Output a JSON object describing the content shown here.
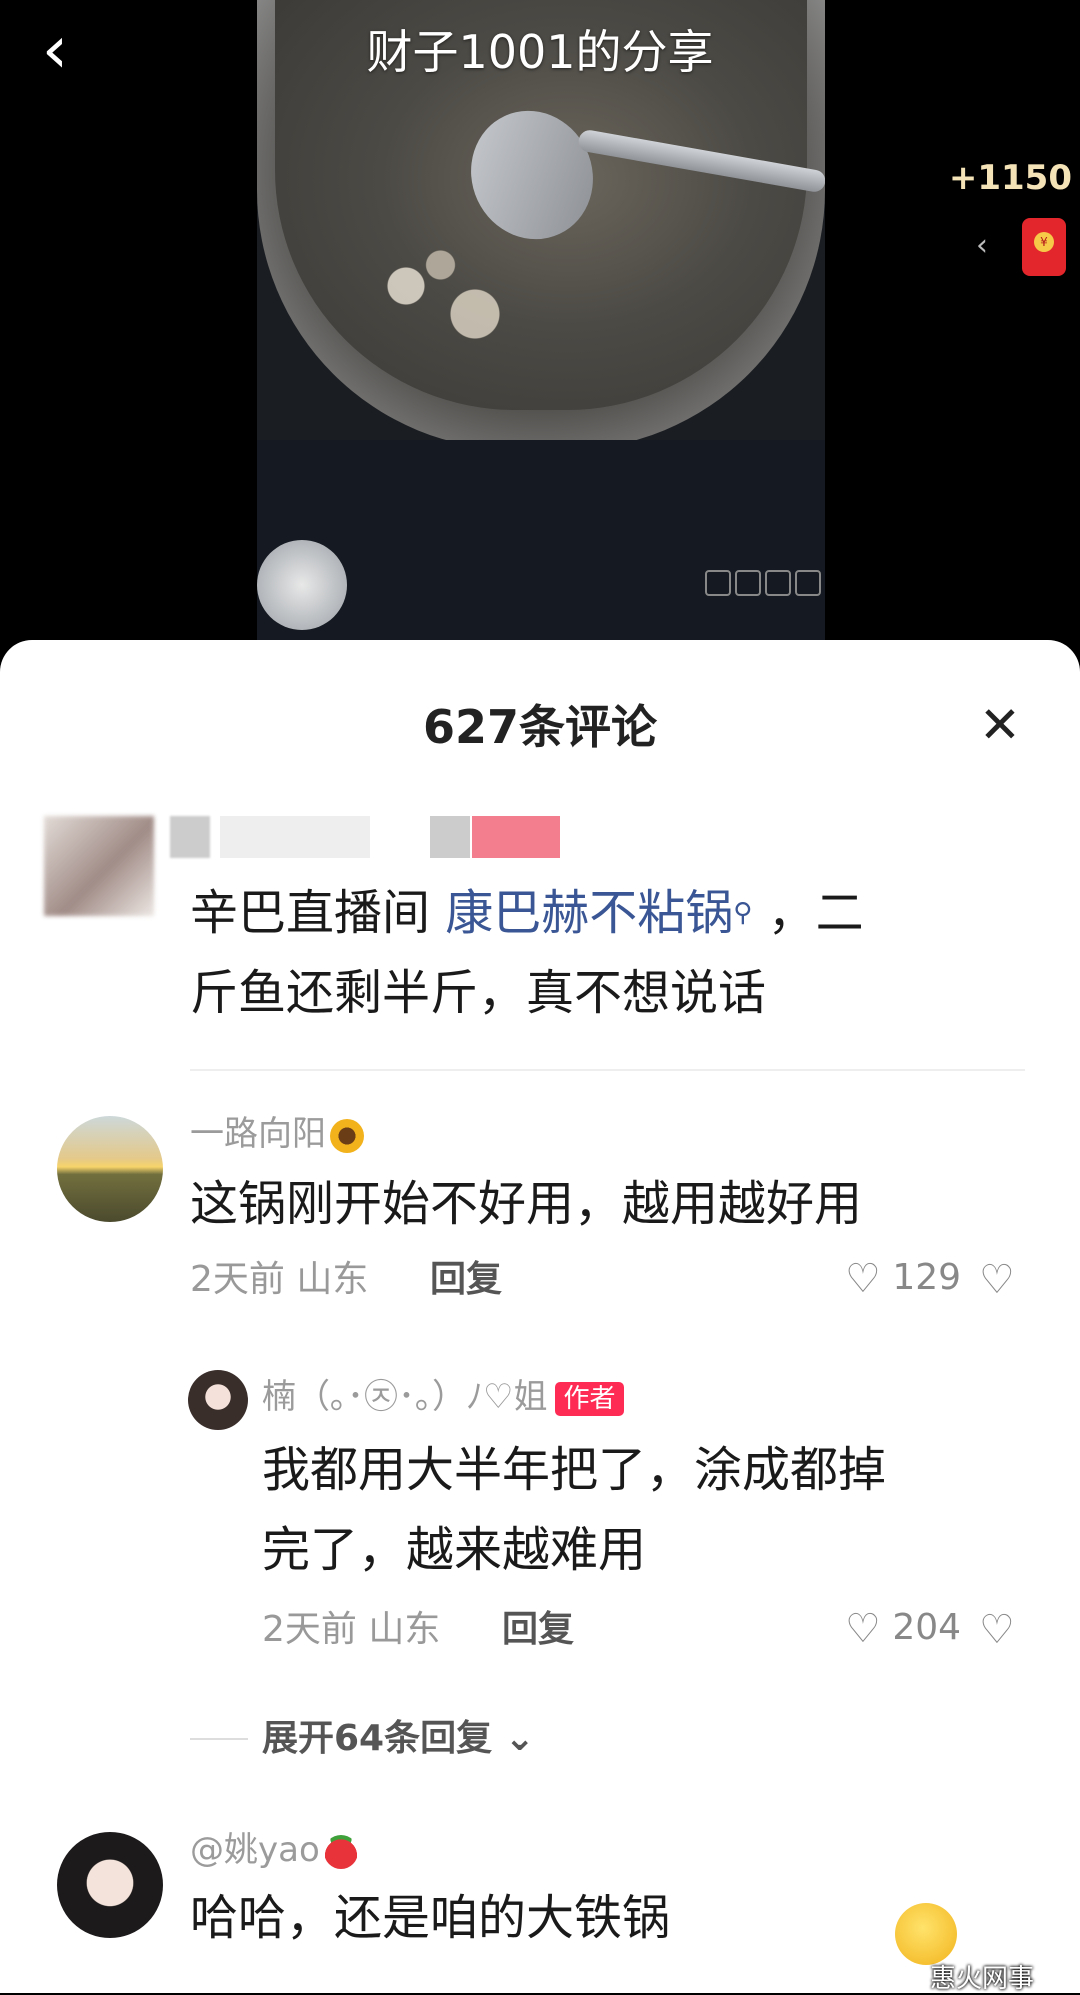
{
  "video": {
    "title": "财子1001的分享",
    "coins": "+1150",
    "back_icon": "chevron-left-icon",
    "red_packet_icon": "red-packet-icon"
  },
  "comments_panel": {
    "title": "627条评论",
    "close_icon": "close-icon",
    "top_comment": {
      "text_prefix": "辛巴直播间 ",
      "link_text": "康巴赫不粘锅",
      "link_suffix_icon": "search-icon",
      "text_line1_end": " ，二",
      "text_line2": "斤鱼还剩半斤，真不想说话"
    },
    "comments": [
      {
        "username": "一路向阳",
        "text": "这锅刚开始不好用，越用越好用",
        "time": "2天前",
        "location": "山东",
        "reply_label": "回复",
        "likes": "129"
      },
      {
        "username": "楠（｡･㉨･｡）ﾉ♡姐",
        "badge": "作者",
        "text_line1": "我都用大半年把了，涂成都掉",
        "text_line2": "完了，越来越难用",
        "time": "2天前",
        "location": "山东",
        "reply_label": "回复",
        "likes": "204"
      }
    ],
    "expand_replies": "展开64条回复",
    "last_comment": {
      "username": "@姚yao",
      "text": "哈哈，还是咱的大铁锅"
    }
  },
  "watermark": "惠火网事"
}
